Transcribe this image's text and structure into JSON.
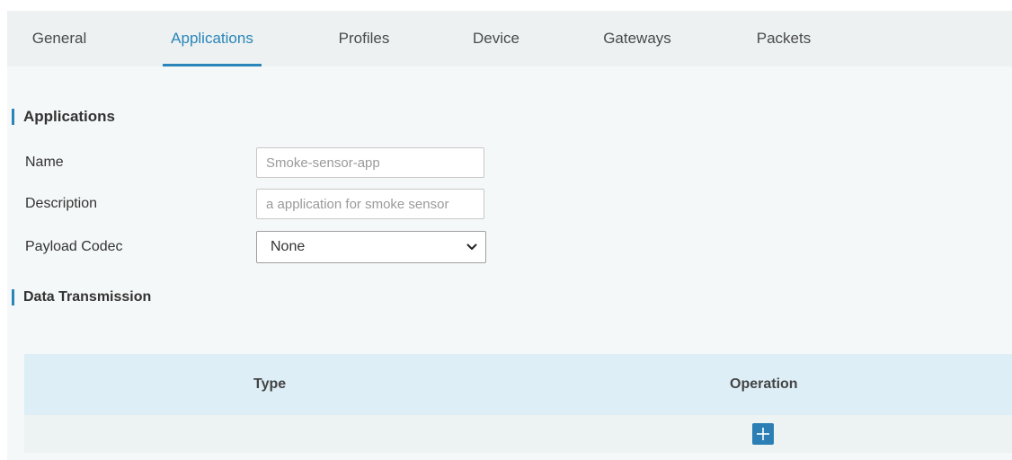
{
  "tabs": [
    {
      "label": "General",
      "active": false
    },
    {
      "label": "Applications",
      "active": true
    },
    {
      "label": "Profiles",
      "active": false
    },
    {
      "label": "Device",
      "active": false
    },
    {
      "label": "Gateways",
      "active": false
    },
    {
      "label": "Packets",
      "active": false
    }
  ],
  "applications_section": {
    "title": "Applications",
    "fields": {
      "name": {
        "label": "Name",
        "placeholder": "Smoke-sensor-app"
      },
      "description": {
        "label": "Description",
        "placeholder": "a application for smoke sensor"
      },
      "payload_codec": {
        "label": "Payload Codec",
        "value": "None"
      }
    }
  },
  "data_transmission_section": {
    "title": "Data Transmission",
    "table": {
      "columns": [
        "Type",
        "Operation"
      ],
      "add_icon": "plus-icon"
    }
  },
  "colors": {
    "accent": "#2a86b8",
    "tab_bar_bg": "#edf1f2",
    "table_header_bg": "#ddeef6",
    "add_button_bg": "#2c7fb4"
  }
}
